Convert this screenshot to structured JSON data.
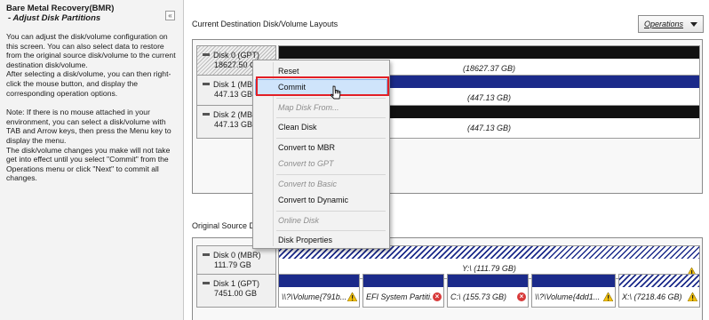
{
  "left_panel": {
    "title": "Bare Metal Recovery(BMR)",
    "subtitle": "- Adjust Disk Partitions",
    "collapse_glyph": "«",
    "paragraphs": [
      "You can adjust the disk/volume configuration on this screen. You can also select data to restore from the original source disk/volume to the current destination disk/volume.",
      "After selecting a disk/volume, you can then right-click the mouse button, and display the corresponding operation options.",
      "Note: If there is no mouse attached in your environment, you can select a disk/volume with TAB and Arrow keys, then press the Menu key to display the menu.",
      "The disk/volume changes you make will not take get into effect until you select \"Commit\" from the Operations menu or click \"Next\" to commit all changes."
    ]
  },
  "destination": {
    "label": "Current Destination Disk/Volume Layouts",
    "operations_button": "Operations",
    "disks": [
      {
        "name": "Disk 0 (GPT)",
        "size": "18627.50 GB",
        "volume_text": "(18627.37 GB)"
      },
      {
        "name": "Disk 1 (MBR)",
        "size": "447.13 GB",
        "volume_text": "(447.13 GB)"
      },
      {
        "name": "Disk 2 (MBR)",
        "size": "447.13 GB",
        "volume_text": "(447.13 GB)"
      }
    ]
  },
  "source": {
    "label": "Original Source Disk/Volume Layouts",
    "disks": [
      {
        "name": "Disk 0 (MBR)",
        "size": "111.79 GB",
        "volumes": [
          {
            "text": "Y:\\ (111.79 GB)"
          }
        ]
      },
      {
        "name": "Disk 1 (GPT)",
        "size": "7451.00 GB",
        "volumes": [
          {
            "text": "\\\\?\\Volume{791b..."
          },
          {
            "text": "EFI System Partiti..."
          },
          {
            "text": "C:\\ (155.73 GB)"
          },
          {
            "text": "\\\\?\\Volume{4dd1..."
          },
          {
            "text": "X:\\ (7218.46 GB)"
          }
        ]
      }
    ]
  },
  "context_menu": {
    "items": [
      {
        "label": "Reset",
        "enabled": true
      },
      {
        "label": "Commit",
        "enabled": true,
        "highlighted": true
      },
      {
        "label": "Map Disk From...",
        "enabled": false
      },
      {
        "label": "Clean Disk",
        "enabled": true
      },
      {
        "label": "Convert to MBR",
        "enabled": true
      },
      {
        "label": "Convert to GPT",
        "enabled": false
      },
      {
        "label": "Convert to Basic",
        "enabled": false
      },
      {
        "label": "Convert to Dynamic",
        "enabled": true
      },
      {
        "label": "Online Disk",
        "enabled": false
      },
      {
        "label": "Disk Properties",
        "enabled": true
      }
    ]
  },
  "colors": {
    "volume_bar_black": "#111111",
    "volume_bar_blue": "#1b2a8a",
    "menu_highlight": "#cfe4fb",
    "annotation_red": "#e21f26",
    "warning_yellow": "#f4c20d",
    "error_red": "#d83a3a"
  },
  "icons": {
    "warning": "warning-icon",
    "error": "error-icon",
    "cursor": "mouse-pointer-icon",
    "dropdown": "chevron-down-icon"
  }
}
